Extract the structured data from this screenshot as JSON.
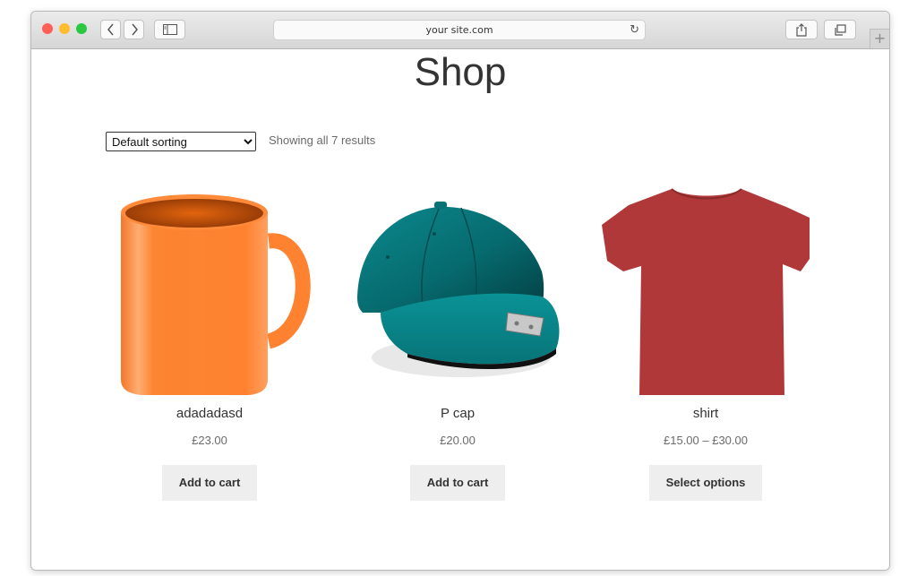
{
  "browser": {
    "url": "your site.com",
    "reload_glyph": "↻",
    "back_glyph": "‹",
    "forward_glyph": "›",
    "new_tab_glyph": "+",
    "traffic_lights": {
      "close": "#ff5f57",
      "minimize": "#febc2e",
      "zoom": "#28c840"
    }
  },
  "page": {
    "title": "Shop",
    "sorting": {
      "selected": "Default sorting"
    },
    "result_count": "Showing all 7 results"
  },
  "products": [
    {
      "name": "adadadasd",
      "price": "£23.00",
      "button": "Add to cart",
      "image": "orange-mug"
    },
    {
      "name": "P cap",
      "price": "£20.00",
      "button": "Add to cart",
      "image": "teal-cap"
    },
    {
      "name": "shirt",
      "price": "£15.00 – £30.00",
      "button": "Select options",
      "image": "red-tshirt"
    }
  ]
}
